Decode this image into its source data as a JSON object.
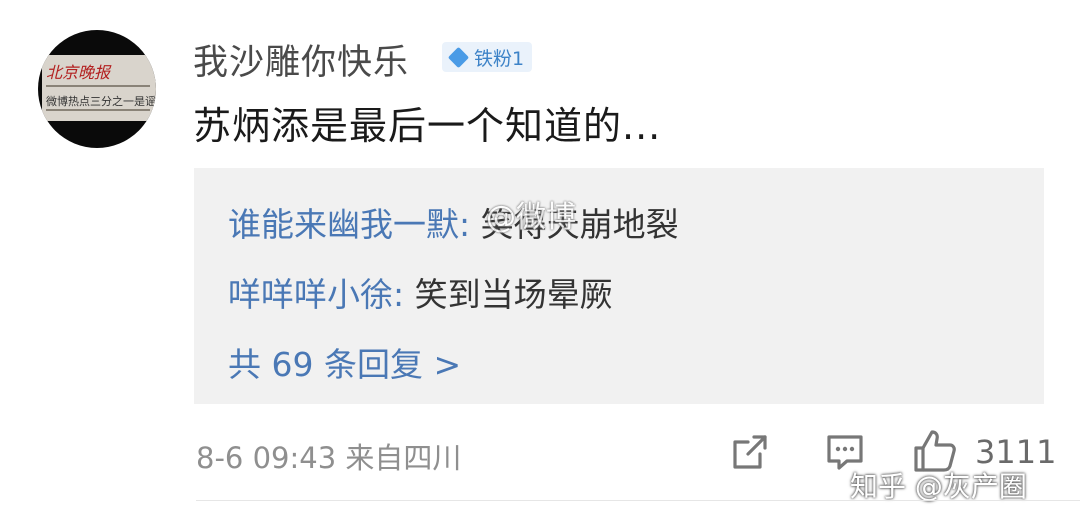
{
  "post": {
    "avatar_text_line1": "北京晚报",
    "avatar_text_line2": "微博热点三分之一是谣言",
    "username": "我沙雕你快乐",
    "badge": "铁粉1",
    "text": "苏炳添是最后一个知道的..."
  },
  "replies": [
    {
      "name": "谁能来幽我一默:",
      "text": " 笑得天崩地裂"
    },
    {
      "name": "咩咩咩小徐:",
      "text": " 笑到当场晕厥"
    }
  ],
  "more_replies": "共 69 条回复 >",
  "watermarks": {
    "weibo": "@微博",
    "zhihu": "知乎 @灰产圈"
  },
  "footer": {
    "meta": "8-6 09:43 来自四川",
    "like_count": "3111"
  },
  "icons": {
    "share": "share-icon",
    "comment": "comment-icon",
    "like": "thumbs-up-icon",
    "badge": "diamond-icon"
  },
  "colors": {
    "accent": "#4a78b5",
    "badge_bg": "#eaf2fb",
    "reply_bg": "#f1f1f1",
    "meta_text": "#8f8f8f"
  }
}
